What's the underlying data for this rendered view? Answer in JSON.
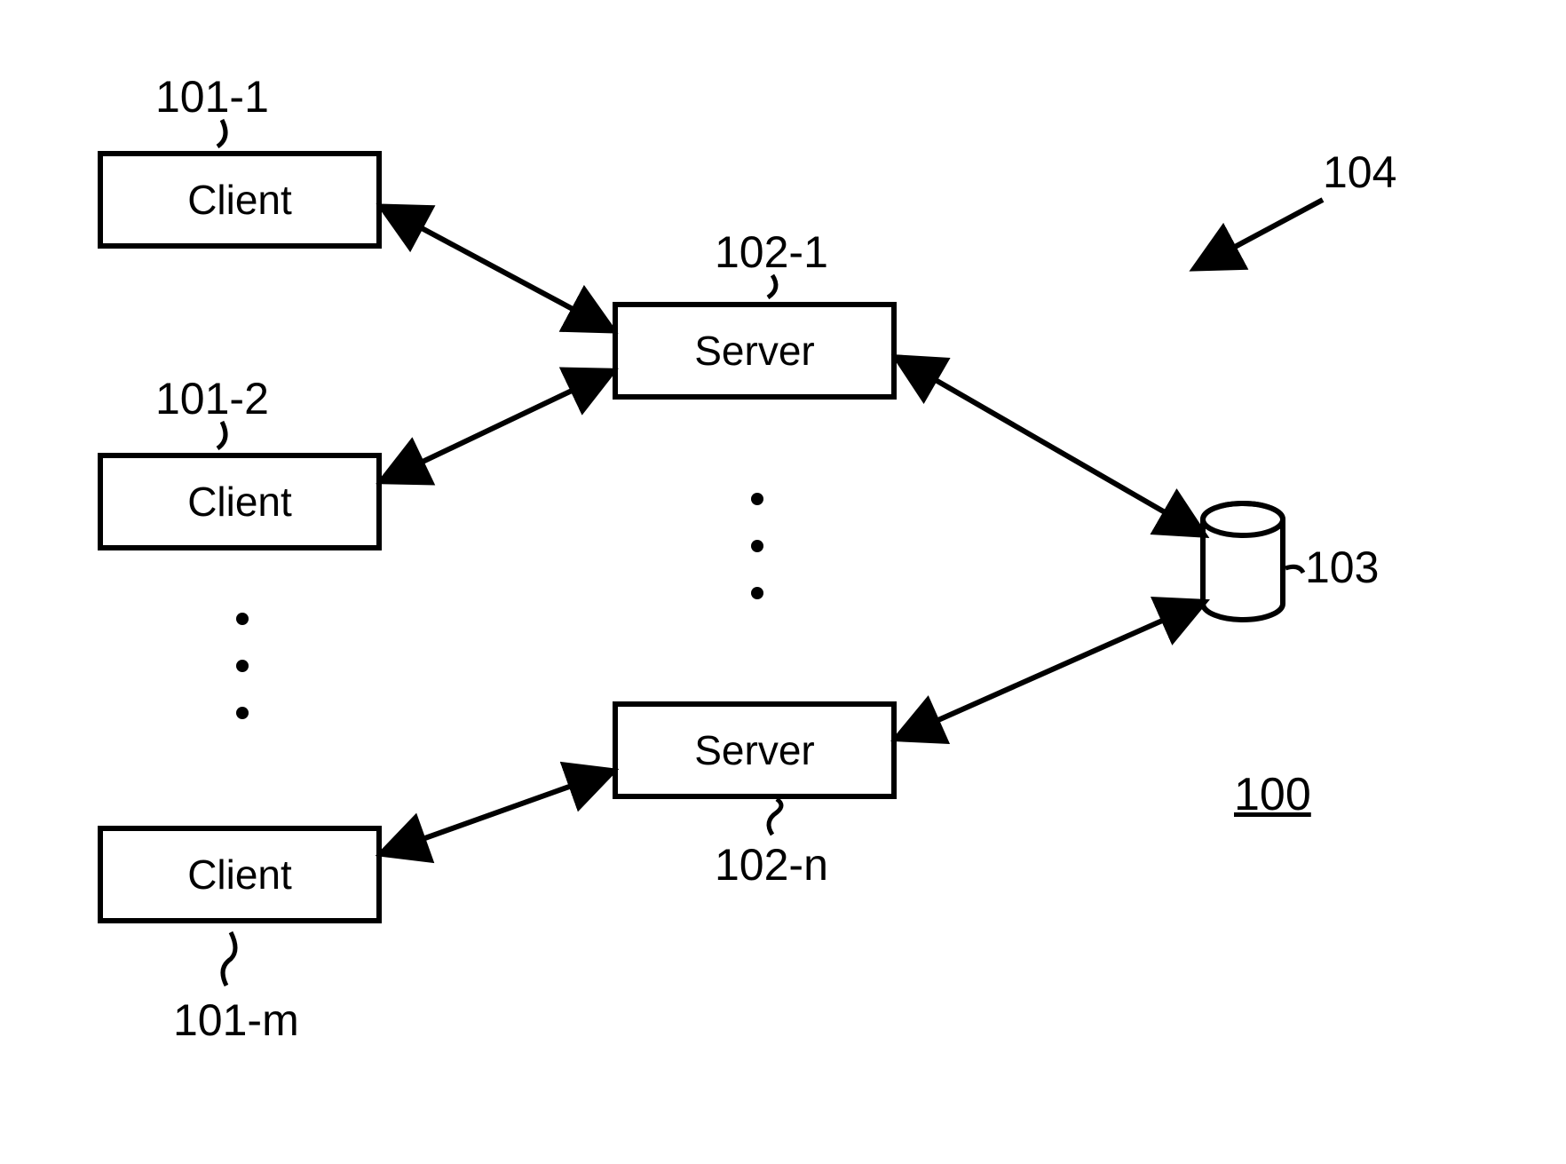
{
  "boxes": {
    "client1": "Client",
    "client2": "Client",
    "clientm": "Client",
    "server1": "Server",
    "servern": "Server"
  },
  "labels": {
    "client1": "101-1",
    "client2": "101-2",
    "clientm": "101-m",
    "server1": "102-1",
    "servern": "102-n",
    "db": "103",
    "system": "104"
  },
  "figure": "100"
}
